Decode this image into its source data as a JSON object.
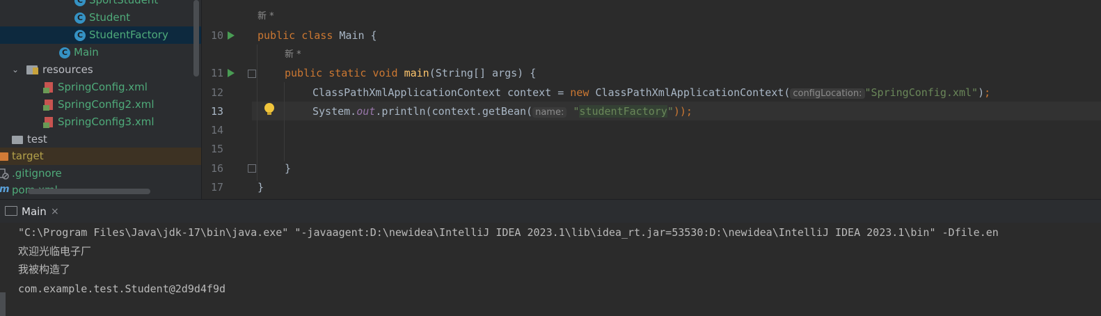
{
  "project_tree": {
    "items": [
      {
        "label": "SportStudent",
        "icon": "class-icon"
      },
      {
        "label": "Student",
        "icon": "class-icon"
      },
      {
        "label": "StudentFactory",
        "icon": "class-icon"
      },
      {
        "label": "Main",
        "icon": "class-icon"
      },
      {
        "label": "resources",
        "icon": "resources-folder-icon"
      },
      {
        "label": "SpringConfig.xml",
        "icon": "spring-xml-icon"
      },
      {
        "label": "SpringConfig2.xml",
        "icon": "spring-xml-icon"
      },
      {
        "label": "SpringConfig3.xml",
        "icon": "spring-xml-icon"
      },
      {
        "label": "test",
        "icon": "folder-icon"
      },
      {
        "label": "target",
        "icon": "folder-icon"
      },
      {
        "label": ".gitignore",
        "icon": "gitignore-icon"
      },
      {
        "label": "pom.xml",
        "icon": "maven-icon"
      }
    ]
  },
  "editor": {
    "line_numbers": [
      "10",
      "11",
      "12",
      "13",
      "14",
      "15",
      "16",
      "17"
    ],
    "active_line": "13",
    "author_hint": "新 *",
    "code": {
      "l10_kw1": "public",
      "l10_kw2": "class",
      "l10_name": "Main {",
      "l11_kw": "public static void",
      "l11_fn": "main",
      "l11_rest": "(String[] args) {",
      "l12_a": "ClassPathXmlApplicationContext context = ",
      "l12_new": "new",
      "l12_b": " ClassPathXmlApplicationContext(",
      "l12_hint": "configLocation:",
      "l12_str": "\"SpringConfig.xml\"",
      "l12_end1": ")",
      "l12_end2": ";",
      "l13_a": "System.",
      "l13_field": "out",
      "l13_b": ".println(context.getBean(",
      "l13_hint": "name:",
      "l13_str_q1": "\"",
      "l13_str": "studentFactory",
      "l13_str_q2": "\"",
      "l13_end1": "));",
      "l16": "}",
      "l17": "}"
    }
  },
  "run_panel": {
    "tab_label": "Main",
    "close_glyph": "×",
    "output": [
      "\"C:\\Program Files\\Java\\jdk-17\\bin\\java.exe\" \"-javaagent:D:\\newidea\\IntelliJ IDEA 2023.1\\lib\\idea_rt.jar=53530:D:\\newidea\\IntelliJ IDEA 2023.1\\bin\" -Dfile.en",
      "欢迎光临电子厂",
      "我被构造了",
      "com.example.test.Student@2d9d4f9d"
    ]
  }
}
